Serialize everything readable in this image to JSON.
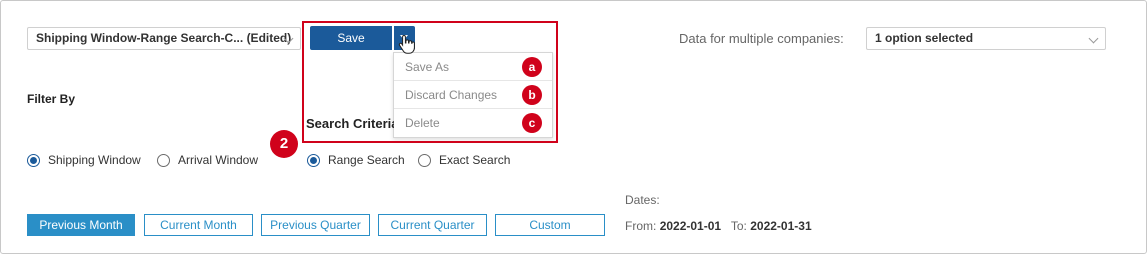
{
  "view_selector": {
    "value": "Shipping Window-Range Search-C... (Edited)"
  },
  "save_button": {
    "label": "Save"
  },
  "save_menu": {
    "items": [
      {
        "label": "Save As",
        "badge": "a"
      },
      {
        "label": "Discard Changes",
        "badge": "b"
      },
      {
        "label": "Delete",
        "badge": "c"
      }
    ]
  },
  "step_badge": "2",
  "companies": {
    "label": "Data for multiple companies:",
    "value": "1 option selected"
  },
  "filter_by": {
    "title": "Filter By"
  },
  "search_criteria": {
    "title": "Search Criteria"
  },
  "window_type": {
    "options": [
      {
        "label": "Shipping Window",
        "selected": true
      },
      {
        "label": "Arrival Window",
        "selected": false
      }
    ]
  },
  "search_type": {
    "options": [
      {
        "label": "Range Search",
        "selected": true
      },
      {
        "label": "Exact Search",
        "selected": false
      }
    ]
  },
  "date_ranges": {
    "buttons": [
      {
        "label": "Previous Month",
        "active": true
      },
      {
        "label": "Current Month",
        "active": false
      },
      {
        "label": "Previous Quarter",
        "active": false
      },
      {
        "label": "Current Quarter",
        "active": false
      },
      {
        "label": "Custom",
        "active": false
      }
    ]
  },
  "dates": {
    "label": "Dates:",
    "from_label": "From:",
    "from": "2022-01-01",
    "to_label": "To:",
    "to": "2022-01-31"
  },
  "colors": {
    "primary": "#1b5a9a",
    "accent": "#2a8fc7",
    "annotation": "#d0021b"
  }
}
